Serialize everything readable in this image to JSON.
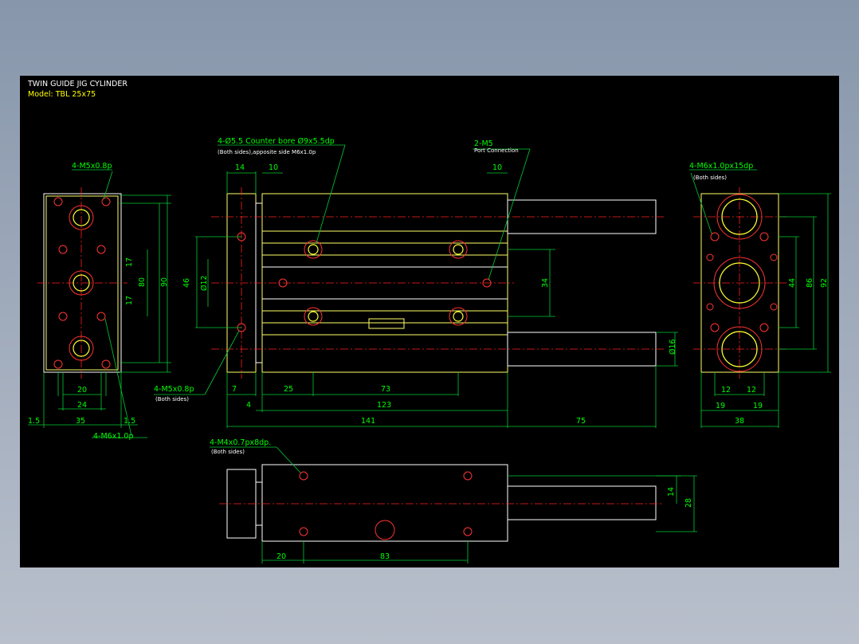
{
  "drawing": {
    "title": "TWIN GUIDE JIG CYLINDER",
    "model": "Model: TBL 25x75"
  },
  "colors": {
    "background": "#000000",
    "outline": "#ffff66",
    "centerline": "#ff2020",
    "dimension": "#00ff00",
    "frame": "#8796ab"
  },
  "notes": {
    "counterbore": "4-Ø5.5 Counter bore Ø9x5.5dp",
    "counterbore_sub": "(Both sides),apposite side M6x1.0p",
    "port": "2-M5",
    "port_sub": "Port Connection",
    "left_top": "4-M5x0.8p",
    "left_bottom": "4-M6x1.0p",
    "right_top": "4-M6x1.0px15dp",
    "right_top_sub": "(Both sides)",
    "side_m5": "4-M5x0.8p",
    "side_m5_sub": "(Both sides)",
    "bottom_m4": "4-M4x0.7px8dp.",
    "bottom_m4_sub": "(Both sides)"
  },
  "dims": {
    "d14": "14",
    "d10a": "10",
    "d10b": "10",
    "d46": "46",
    "phi12": "Ø12",
    "d34": "34",
    "phi16": "Ø16",
    "d7": "7",
    "d25": "25",
    "d73": "73",
    "d4": "4",
    "d123": "123",
    "d141": "141",
    "d75": "75",
    "l17a": "17",
    "l17b": "17",
    "l80": "80",
    "l90": "90",
    "l20": "20",
    "l24": "24",
    "l15a": "1.5",
    "l35": "35",
    "l15b": "1.5",
    "r44": "44",
    "r86": "86",
    "r92": "92",
    "r12a": "12",
    "r12b": "12",
    "r19a": "19",
    "r19b": "19",
    "r38": "38",
    "b14": "14",
    "b28": "28",
    "b20": "20",
    "b83": "83"
  }
}
